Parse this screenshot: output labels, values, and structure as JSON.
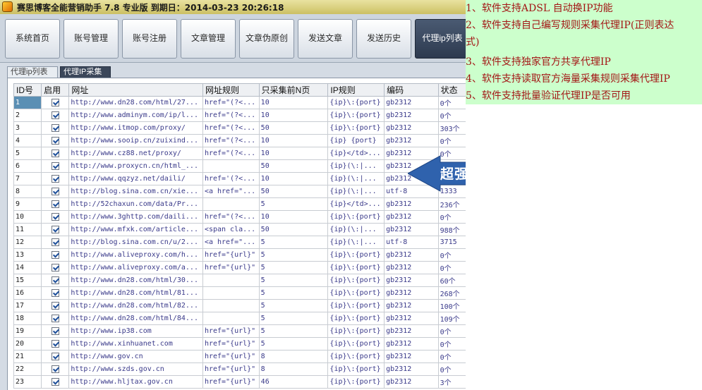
{
  "app": {
    "title": "赛思博客全能营销助手 7.8  专业版  到期日：2014-03-23  20:26:18"
  },
  "toolbar": {
    "buttons": [
      "系统首页",
      "账号管理",
      "账号注册",
      "文章管理",
      "文章伪原创",
      "发送文章",
      "发送历史",
      "代理ip列表"
    ],
    "active": "代理ip列表"
  },
  "subtabs": {
    "items": [
      "代理ip列表",
      "代理IP采集"
    ],
    "active": "代理IP采集"
  },
  "grid": {
    "columns": [
      "ID号",
      "启用",
      "网址",
      "网址规则",
      "只采集前N页",
      "IP规则",
      "编码",
      "状态"
    ],
    "selected_row": 1,
    "rows": [
      {
        "id": "1",
        "enabled": true,
        "url": "http://www.dn28.com/html/27...",
        "url_rule": "href=\"(?<...",
        "pages": "10",
        "ip_rule": "{ip}\\:{port}",
        "encoding": "gb2312",
        "status": "0个"
      },
      {
        "id": "2",
        "enabled": true,
        "url": "http://www.adminym.com/ip/l...",
        "url_rule": "href=\"(?<...",
        "pages": "10",
        "ip_rule": "{ip}\\:{port}",
        "encoding": "gb2312",
        "status": "0个"
      },
      {
        "id": "3",
        "enabled": true,
        "url": "http://www.itmop.com/proxy/",
        "url_rule": "href=\"(?<...",
        "pages": "50",
        "ip_rule": "{ip}\\:{port}",
        "encoding": "gb2312",
        "status": "303个"
      },
      {
        "id": "4",
        "enabled": true,
        "url": "http://www.sooip.cn/zuixind...",
        "url_rule": "href=\"(?<...",
        "pages": "10",
        "ip_rule": "{ip} {port}",
        "encoding": "gb2312",
        "status": "0个"
      },
      {
        "id": "5",
        "enabled": true,
        "url": "http://www.cz88.net/proxy/",
        "url_rule": "href=\"(?<...",
        "pages": "10",
        "ip_rule": "{ip}</td>...",
        "encoding": "gb2312",
        "status": "0个"
      },
      {
        "id": "6",
        "enabled": true,
        "url": "http://www.proxycn.cn/html_...",
        "url_rule": "",
        "pages": "50",
        "ip_rule": "{ip}(\\:|...",
        "encoding": "gb2312",
        "status": "0个"
      },
      {
        "id": "7",
        "enabled": true,
        "url": "http://www.qqzyz.net/daili/",
        "url_rule": "href='(?<...",
        "pages": "10",
        "ip_rule": "{ip}(\\:|...",
        "encoding": "gb2312",
        "status": "0个"
      },
      {
        "id": "8",
        "enabled": true,
        "url": "http://blog.sina.com.cn/xie...",
        "url_rule": "<a href=\"...",
        "pages": "50",
        "ip_rule": "{ip}(\\:|...",
        "encoding": "utf-8",
        "status": "1333"
      },
      {
        "id": "9",
        "enabled": true,
        "url": "http://52chaxun.com/data/Pr...",
        "url_rule": "",
        "pages": "5",
        "ip_rule": "{ip}</td>...",
        "encoding": "gb2312",
        "status": "236个"
      },
      {
        "id": "10",
        "enabled": true,
        "url": "http://www.3ghttp.com/daili...",
        "url_rule": "href=\"(?<...",
        "pages": "10",
        "ip_rule": "{ip}\\:{port}",
        "encoding": "gb2312",
        "status": "0个"
      },
      {
        "id": "11",
        "enabled": true,
        "url": "http://www.mfxk.com/article...",
        "url_rule": "<span cla...",
        "pages": "50",
        "ip_rule": "{ip}(\\:|...",
        "encoding": "gb2312",
        "status": "988个"
      },
      {
        "id": "12",
        "enabled": true,
        "url": "http://blog.sina.com.cn/u/2...",
        "url_rule": "<a href=\"...",
        "pages": "5",
        "ip_rule": "{ip}(\\:|...",
        "encoding": "utf-8",
        "status": "3715"
      },
      {
        "id": "13",
        "enabled": true,
        "url": "http://www.aliveproxy.com/h...",
        "url_rule": "href=\"{url}\"",
        "pages": "5",
        "ip_rule": "{ip}\\:{port}",
        "encoding": "gb2312",
        "status": "0个"
      },
      {
        "id": "14",
        "enabled": true,
        "url": "http://www.aliveproxy.com/a...",
        "url_rule": "href=\"{url}\"",
        "pages": "5",
        "ip_rule": "{ip}\\:{port}",
        "encoding": "gb2312",
        "status": "0个"
      },
      {
        "id": "15",
        "enabled": true,
        "url": "http://www.dn28.com/html/30...",
        "url_rule": "",
        "pages": "5",
        "ip_rule": "{ip}\\:{port}",
        "encoding": "gb2312",
        "status": "60个"
      },
      {
        "id": "16",
        "enabled": true,
        "url": "http://www.dn28.com/html/81...",
        "url_rule": "",
        "pages": "5",
        "ip_rule": "{ip}\\:{port}",
        "encoding": "gb2312",
        "status": "268个"
      },
      {
        "id": "17",
        "enabled": true,
        "url": "http://www.dn28.com/html/82...",
        "url_rule": "",
        "pages": "5",
        "ip_rule": "{ip}\\:{port}",
        "encoding": "gb2312",
        "status": "100个"
      },
      {
        "id": "18",
        "enabled": true,
        "url": "http://www.dn28.com/html/84...",
        "url_rule": "",
        "pages": "5",
        "ip_rule": "{ip}\\:{port}",
        "encoding": "gb2312",
        "status": "109个"
      },
      {
        "id": "19",
        "enabled": true,
        "url": "http://www.ip38.com",
        "url_rule": "href=\"{url}\"",
        "pages": "5",
        "ip_rule": "{ip}\\:{port}",
        "encoding": "gb2312",
        "status": "0个"
      },
      {
        "id": "20",
        "enabled": true,
        "url": "http://www.xinhuanet.com",
        "url_rule": "href=\"{url}\"",
        "pages": "5",
        "ip_rule": "{ip}\\:{port}",
        "encoding": "gb2312",
        "status": "0个"
      },
      {
        "id": "21",
        "enabled": true,
        "url": "http://www.gov.cn",
        "url_rule": "href=\"{url}\"",
        "pages": "8",
        "ip_rule": "{ip}\\:{port}",
        "encoding": "gb2312",
        "status": "0个"
      },
      {
        "id": "22",
        "enabled": true,
        "url": "http://www.szds.gov.cn",
        "url_rule": "href=\"{url}\"",
        "pages": "8",
        "ip_rule": "{ip}\\:{port}",
        "encoding": "gb2312",
        "status": "0个"
      },
      {
        "id": "23",
        "enabled": true,
        "url": "http://www.hljtax.gov.cn",
        "url_rule": "href=\"{url}\"",
        "pages": "46",
        "ip_rule": "{ip}\\:{port}",
        "encoding": "gb2312",
        "status": "3个"
      }
    ]
  },
  "callout": {
    "text": "超强IP采集系统",
    "color": "#2f62ad"
  },
  "features": [
    "1、软件支持ADSL 自动换IP功能",
    "2、软件支持自己编写规则采集代理IP(正则表达",
    "式)",
    "3、软件支持独家官方共享代理IP",
    "4、软件支持读取官方海量采集规则采集代理IP",
    "5、软件支持批量验证代理IP是否可用"
  ]
}
